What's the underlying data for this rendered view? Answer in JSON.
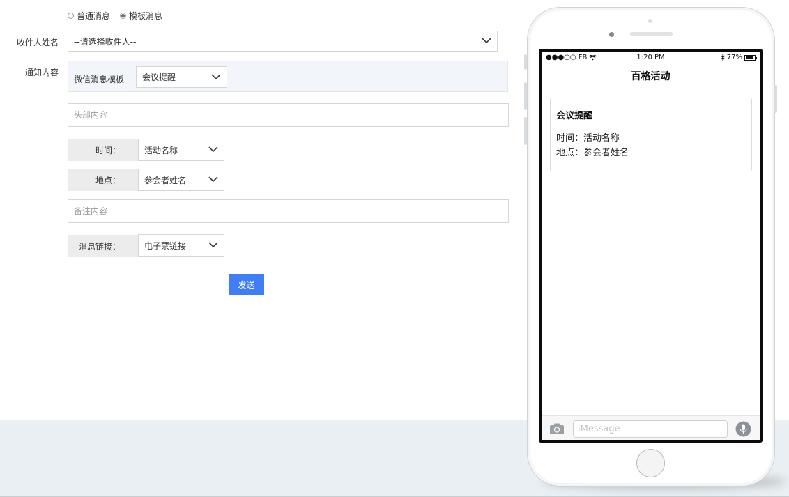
{
  "message_type": {
    "options": [
      {
        "label": "普通消息",
        "checked": false
      },
      {
        "label": "模板消息",
        "checked": true
      }
    ]
  },
  "recipient": {
    "label": "收件人姓名",
    "select_value": "--请选择收件人--"
  },
  "content": {
    "label": "通知内容",
    "template_label": "微信消息模板",
    "template_value": "会议提醒",
    "header_placeholder": "头部内容",
    "fields": [
      {
        "label": "时间：",
        "value": "活动名称"
      },
      {
        "label": "地点：",
        "value": "参会者姓名"
      }
    ],
    "remark_placeholder": "备注内容",
    "link_label": "消息链接：",
    "link_value": "电子票链接"
  },
  "send_label": "发送",
  "phone": {
    "status_carrier": "●●●○○ FB",
    "status_time": "1:20 PM",
    "status_battery": "77%",
    "nav_title": "百格活动",
    "card": {
      "title": "会议提醒",
      "lines": [
        "时间：活动名称",
        "地点：参会者姓名"
      ]
    },
    "imessage_placeholder": "iMessage"
  },
  "colors": {
    "accent": "#3f7ef7",
    "panel_bg": "#f2f6fa",
    "footer_bg": "#e9eff2"
  }
}
